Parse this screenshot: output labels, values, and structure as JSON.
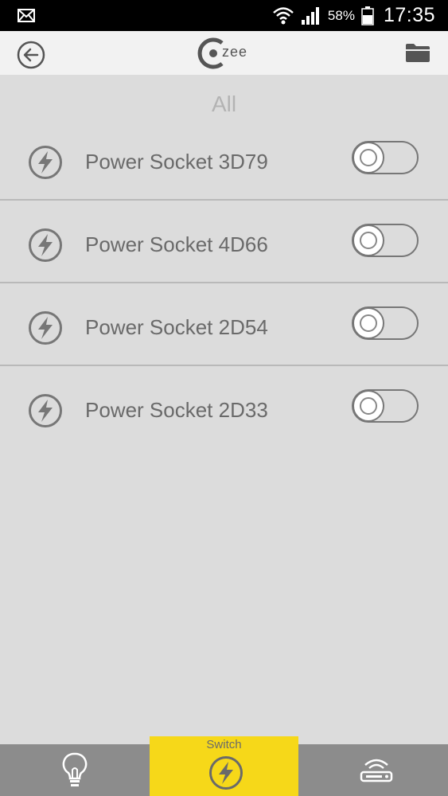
{
  "status_bar": {
    "battery_percent": "58%",
    "time": "17:35",
    "icons": [
      "mail-icon",
      "wifi-icon",
      "signal-icon",
      "battery-icon"
    ]
  },
  "header": {
    "logo_text": "zee",
    "back_icon": "arrow-left-circle-icon",
    "folder_icon": "folder-icon"
  },
  "section": {
    "title": "All"
  },
  "devices": [
    {
      "label": "Power Socket 3D79",
      "on": false
    },
    {
      "label": "Power Socket 4D66",
      "on": false
    },
    {
      "label": "Power Socket 2D54",
      "on": false
    },
    {
      "label": "Power Socket 2D33",
      "on": false
    }
  ],
  "bottom_nav": {
    "active": "Switch",
    "items": [
      {
        "icon": "lightbulb-icon"
      },
      {
        "label": "Switch",
        "icon": "lightning-circle-icon"
      },
      {
        "icon": "router-icon"
      }
    ]
  },
  "colors": {
    "background": "#dcdcdc",
    "header": "#f2f2f2",
    "nav": "#8c8c8c",
    "nav_active": "#f6d819",
    "text": "#6a6a6a"
  }
}
